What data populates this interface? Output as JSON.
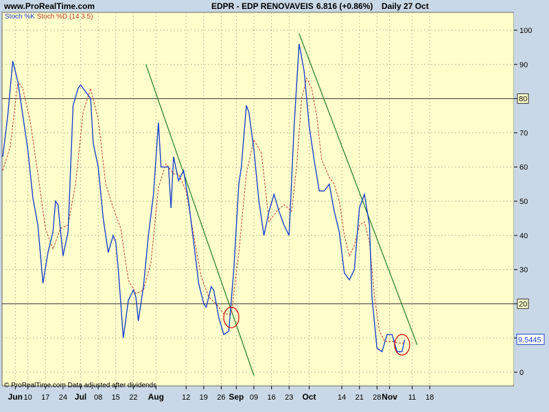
{
  "header": {
    "site": "www.ProRealTime.com",
    "instrument": "EDPR - EDP RENOVAVEIS",
    "price": "6.816 (+0.86%)",
    "period": "Daily  27 Oct"
  },
  "legend": {
    "k_label": "Stoch %K",
    "d_label": "Stoch %D (14 3 5)"
  },
  "footer": "© ProRealTime.com  Data adjusted after dividends",
  "colors": {
    "background": "#c9d8e6",
    "plot_bg": "#ffffcc",
    "k_line": "#1a3fcc",
    "d_line": "#c0392b",
    "trendline": "#1f7a1f",
    "marker": "#cc0000"
  },
  "chart_data": {
    "type": "line",
    "ylim": [
      -4,
      102
    ],
    "yticks": [
      0,
      10,
      20,
      30,
      40,
      50,
      60,
      70,
      80,
      90,
      100
    ],
    "reference_lines": [
      20,
      80
    ],
    "last_value_label": "9.5445",
    "x_labels": [
      {
        "label": "Jun",
        "day": 5
      },
      {
        "label": "10",
        "day": 10
      },
      {
        "label": "17",
        "day": 17
      },
      {
        "label": "24",
        "day": 24
      },
      {
        "label": "Jul",
        "day": 31
      },
      {
        "label": "08",
        "day": 38
      },
      {
        "label": "15",
        "day": 45
      },
      {
        "label": "22",
        "day": 52
      },
      {
        "label": "Aug",
        "day": 61
      },
      {
        "label": "12",
        "day": 73
      },
      {
        "label": "19",
        "day": 80
      },
      {
        "label": "26",
        "day": 87
      },
      {
        "label": "Sep",
        "day": 93
      },
      {
        "label": "09",
        "day": 100
      },
      {
        "label": "16",
        "day": 107
      },
      {
        "label": "23",
        "day": 114
      },
      {
        "label": "Oct",
        "day": 122
      },
      {
        "label": "14",
        "day": 135
      },
      {
        "label": "21",
        "day": 142
      },
      {
        "label": "28",
        "day": 149
      },
      {
        "label": "Nov",
        "day": 154
      },
      {
        "label": "11",
        "day": 163
      },
      {
        "label": "18",
        "day": 170
      }
    ],
    "series": [
      {
        "name": "Stoch %K",
        "points": [
          [
            0,
            63
          ],
          [
            2,
            75
          ],
          [
            4,
            91
          ],
          [
            6,
            85
          ],
          [
            8,
            75
          ],
          [
            10,
            65
          ],
          [
            12,
            51
          ],
          [
            14,
            43
          ],
          [
            16,
            26
          ],
          [
            18,
            35
          ],
          [
            20,
            41
          ],
          [
            21,
            50
          ],
          [
            22,
            49
          ],
          [
            24,
            34
          ],
          [
            26,
            41
          ],
          [
            28,
            78
          ],
          [
            30,
            83
          ],
          [
            31,
            84
          ],
          [
            33,
            82
          ],
          [
            35,
            80
          ],
          [
            36,
            67
          ],
          [
            38,
            60
          ],
          [
            40,
            45
          ],
          [
            42,
            35
          ],
          [
            44,
            40
          ],
          [
            45,
            38
          ],
          [
            46,
            30
          ],
          [
            48,
            10
          ],
          [
            50,
            21
          ],
          [
            52,
            24
          ],
          [
            53,
            22
          ],
          [
            54,
            15
          ],
          [
            56,
            25
          ],
          [
            58,
            40
          ],
          [
            60,
            52
          ],
          [
            62,
            73
          ],
          [
            63,
            60
          ],
          [
            64,
            60
          ],
          [
            66,
            60
          ],
          [
            67,
            48
          ],
          [
            68,
            63
          ],
          [
            70,
            56
          ],
          [
            72,
            59
          ],
          [
            74,
            50
          ],
          [
            76,
            38
          ],
          [
            78,
            26
          ],
          [
            80,
            20
          ],
          [
            81,
            19
          ],
          [
            83,
            25
          ],
          [
            84,
            24
          ],
          [
            86,
            16
          ],
          [
            88,
            11
          ],
          [
            90,
            12
          ],
          [
            92,
            30
          ],
          [
            94,
            55
          ],
          [
            95,
            60
          ],
          [
            97,
            78
          ],
          [
            98,
            76
          ],
          [
            100,
            65
          ],
          [
            102,
            50
          ],
          [
            104,
            40
          ],
          [
            106,
            47
          ],
          [
            108,
            52
          ],
          [
            110,
            47
          ],
          [
            112,
            43
          ],
          [
            114,
            40
          ],
          [
            116,
            72
          ],
          [
            118,
            96
          ],
          [
            120,
            88
          ],
          [
            122,
            72
          ],
          [
            124,
            62
          ],
          [
            126,
            53
          ],
          [
            128,
            53
          ],
          [
            130,
            55
          ],
          [
            132,
            47
          ],
          [
            134,
            41
          ],
          [
            136,
            29
          ],
          [
            138,
            27
          ],
          [
            140,
            30
          ],
          [
            142,
            48
          ],
          [
            144,
            52
          ],
          [
            146,
            43
          ],
          [
            147,
            22
          ],
          [
            149,
            7
          ],
          [
            151,
            6
          ],
          [
            153,
            11
          ],
          [
            155,
            11
          ],
          [
            157,
            6
          ],
          [
            159,
            6
          ],
          [
            160,
            9.5
          ]
        ]
      },
      {
        "name": "Stoch %D (14 3 5)",
        "points": [
          [
            0,
            59
          ],
          [
            3,
            66
          ],
          [
            6,
            85
          ],
          [
            8,
            83
          ],
          [
            11,
            73
          ],
          [
            14,
            58
          ],
          [
            17,
            42
          ],
          [
            20,
            36
          ],
          [
            23,
            42
          ],
          [
            26,
            43
          ],
          [
            29,
            55
          ],
          [
            32,
            76
          ],
          [
            35,
            83
          ],
          [
            38,
            74
          ],
          [
            41,
            55
          ],
          [
            44,
            48
          ],
          [
            47,
            42
          ],
          [
            50,
            27
          ],
          [
            53,
            23
          ],
          [
            56,
            24
          ],
          [
            59,
            32
          ],
          [
            62,
            54
          ],
          [
            65,
            61
          ],
          [
            68,
            58
          ],
          [
            70,
            58
          ],
          [
            73,
            53
          ],
          [
            76,
            40
          ],
          [
            79,
            28
          ],
          [
            82,
            22
          ],
          [
            85,
            20
          ],
          [
            88,
            17
          ],
          [
            91,
            17
          ],
          [
            94,
            35
          ],
          [
            97,
            58
          ],
          [
            100,
            68
          ],
          [
            103,
            64
          ],
          [
            106,
            44
          ],
          [
            109,
            47
          ],
          [
            112,
            49
          ],
          [
            115,
            47
          ],
          [
            117,
            60
          ],
          [
            119,
            80
          ],
          [
            121,
            86
          ],
          [
            123,
            83
          ],
          [
            125,
            75
          ],
          [
            127,
            62
          ],
          [
            130,
            57
          ],
          [
            132,
            55
          ],
          [
            134,
            50
          ],
          [
            136,
            40
          ],
          [
            138,
            34
          ],
          [
            140,
            37
          ],
          [
            142,
            43
          ],
          [
            144,
            44
          ],
          [
            146,
            38
          ],
          [
            148,
            22
          ],
          [
            150,
            12
          ],
          [
            152,
            9
          ],
          [
            155,
            9
          ],
          [
            158,
            8.5
          ],
          [
            160,
            8.5
          ]
        ]
      }
    ],
    "trendlines": [
      {
        "from": [
          57,
          90
        ],
        "to": [
          100,
          -1
        ]
      },
      {
        "from": [
          118,
          99
        ],
        "to": [
          165,
          8
        ]
      }
    ],
    "circled_points": [
      [
        91,
        16
      ],
      [
        159,
        8
      ]
    ]
  }
}
